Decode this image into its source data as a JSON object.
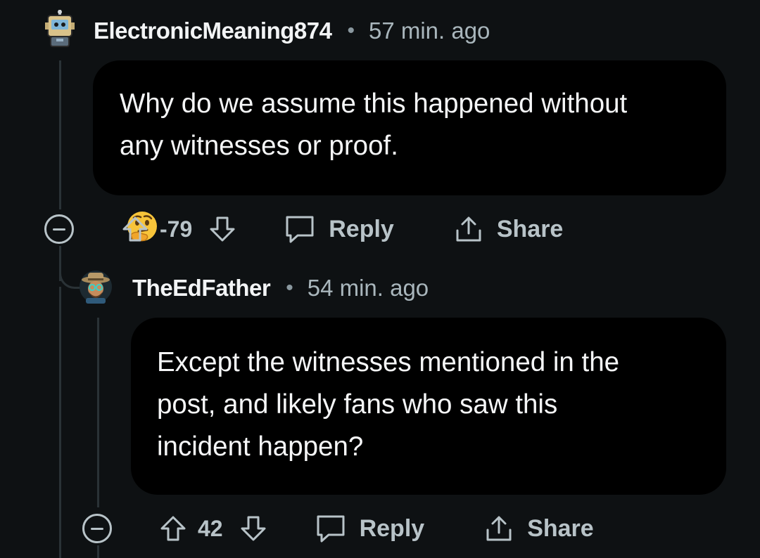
{
  "comments": [
    {
      "username": "ElectronicMeaning874",
      "separator": "•",
      "timestamp": "57 min. ago",
      "body": "Why do we assume this happened without\nany witnesses or proof.",
      "emoji": "🤔",
      "score": "-79",
      "reply_label": "Reply",
      "share_label": "Share"
    },
    {
      "username": "TheEdFather",
      "separator": "•",
      "timestamp": "54 min. ago",
      "body": "Except the witnesses mentioned in the\npost, and likely fans who saw this\nincident happen?",
      "score": "42",
      "reply_label": "Reply",
      "share_label": "Share"
    }
  ],
  "icons": {
    "collapse": "collapse-minus-icon",
    "upvote": "upvote-arrow-icon",
    "downvote": "downvote-arrow-icon",
    "reply": "speech-bubble-icon",
    "share": "share-arrow-icon"
  }
}
